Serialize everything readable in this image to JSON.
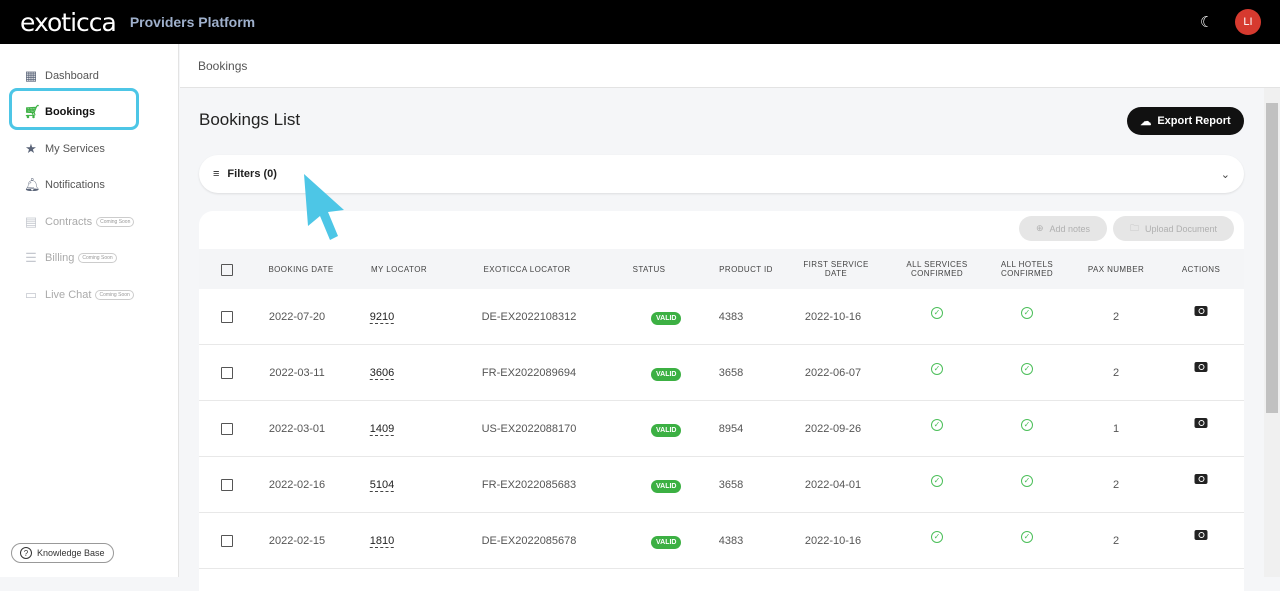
{
  "header": {
    "logo": "exoticca",
    "platform": "Providers Platform",
    "avatar": "LI"
  },
  "sidebar": {
    "items": [
      {
        "label": "Dashboard",
        "icon": "dashboard-icon"
      },
      {
        "label": "Bookings",
        "icon": "cart-icon"
      },
      {
        "label": "My Services",
        "icon": "star-icon"
      },
      {
        "label": "Notifications",
        "icon": "bell-icon"
      },
      {
        "label": "Contracts",
        "icon": "document-icon",
        "badge": "Coming Soon"
      },
      {
        "label": "Billing",
        "icon": "billing-icon",
        "badge": "Coming Soon"
      },
      {
        "label": "Live Chat",
        "icon": "chat-icon",
        "badge": "Coming Soon"
      }
    ],
    "knowledge_base": "Knowledge Base"
  },
  "breadcrumb": "Bookings",
  "main": {
    "title": "Bookings List",
    "export": "Export Report",
    "filters": "Filters (0)",
    "add_notes": "Add notes",
    "upload": "Upload Document",
    "columns": [
      "BOOKING DATE",
      "MY LOCATOR",
      "EXOTICCA LOCATOR",
      "STATUS",
      "PRODUCT ID",
      "FIRST SERVICE DATE",
      "ALL SERVICES CONFIRMED",
      "ALL HOTELS CONFIRMED",
      "PAX NUMBER",
      "ACTIONS"
    ],
    "rows": [
      {
        "date": "2022-07-20",
        "my": "9210",
        "ex": "DE-EX2022108312",
        "status": "VALID",
        "pid": "4383",
        "first": "2022-10-16",
        "pax": "2"
      },
      {
        "date": "2022-03-11",
        "my": "3606",
        "ex": "FR-EX2022089694",
        "status": "VALID",
        "pid": "3658",
        "first": "2022-06-07",
        "pax": "2"
      },
      {
        "date": "2022-03-01",
        "my": "1409",
        "ex": "US-EX2022088170",
        "status": "VALID",
        "pid": "8954",
        "first": "2022-09-26",
        "pax": "1"
      },
      {
        "date": "2022-02-16",
        "my": "5104",
        "ex": "FR-EX2022085683",
        "status": "VALID",
        "pid": "3658",
        "first": "2022-04-01",
        "pax": "2"
      },
      {
        "date": "2022-02-15",
        "my": "1810",
        "ex": "DE-EX2022085678",
        "status": "VALID",
        "pid": "4383",
        "first": "2022-10-16",
        "pax": "2"
      }
    ]
  },
  "colors": {
    "accent": "#4dc6e6",
    "valid": "#3cb043"
  }
}
